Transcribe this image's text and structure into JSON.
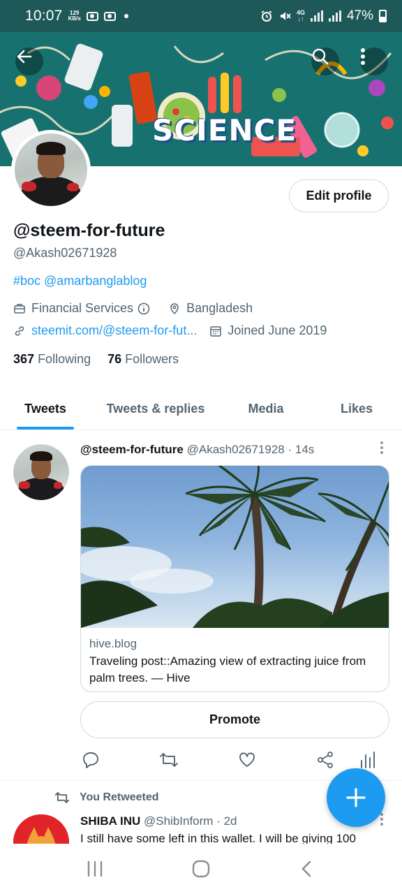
{
  "status_bar": {
    "time": "10:07",
    "net_speed_value": "129",
    "net_speed_unit": "KB/s",
    "network_type": "4G",
    "battery": "47%"
  },
  "banner": {
    "text": "SCIENCE",
    "icons": [
      "back-arrow-icon",
      "search-icon",
      "more-vertical-icon"
    ]
  },
  "profile": {
    "edit_button": "Edit profile",
    "display_name": "@steem-for-future",
    "handle": "@Akash02671928",
    "bio": "#boc @amarbanglablog",
    "category": "Financial Services",
    "location": "Bangladesh",
    "website": "steemit.com/@steem-for-fut...",
    "joined": "Joined June 2019",
    "following_count": "367",
    "following_label": "Following",
    "followers_count": "76",
    "followers_label": "Followers"
  },
  "tabs": [
    "Tweets",
    "Tweets & replies",
    "Media",
    "Likes"
  ],
  "active_tab": "Tweets",
  "tweets": [
    {
      "name": "@steem-for-future",
      "handle": "@Akash02671928",
      "time": "· 14s",
      "card": {
        "domain": "hive.blog",
        "title": "Traveling post::Amazing view of extracting juice from palm trees. — Hive"
      },
      "promote": "Promote"
    },
    {
      "retweet_label": "You Retweeted",
      "name": "SHIBA INU",
      "handle": "@ShibInform",
      "time": "· 2d",
      "text": "I still have some left in this wallet. I will be giving 100"
    }
  ],
  "colors": {
    "accent": "#1d9bf0",
    "status_bar": "#1e5858",
    "text_secondary": "#536471"
  }
}
